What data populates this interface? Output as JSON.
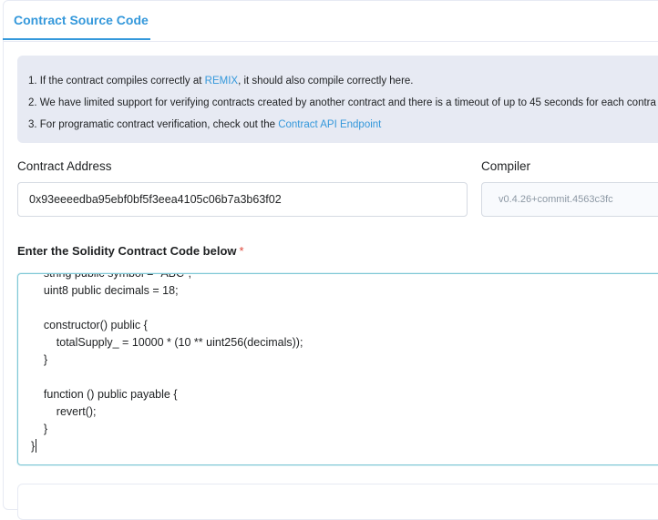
{
  "tabs": [
    {
      "label": "Contract Source Code",
      "active": true
    }
  ],
  "notice": {
    "item1_prefix": "1. If the contract compiles correctly at ",
    "item1_link": "REMIX",
    "item1_suffix": ", it should also compile correctly here.",
    "item2": "2. We have limited support for verifying contracts created by another contract and there is a timeout of up to 45 seconds for each contra",
    "item3_prefix": "3. For programatic contract verification, check out the ",
    "item3_link": "Contract API Endpoint"
  },
  "form": {
    "address_label": "Contract Address",
    "address_value": "0x93eeeedba95ebf0bf5f3eea4105c06b7a3b63f02",
    "compiler_label": "Compiler",
    "compiler_value": "v0.4.26+commit.4563c3fc",
    "code_label": "Enter the Solidity Contract Code below",
    "code_required_mark": "*",
    "code_value": "    string public symbol = \"ABC\";\n    uint8 public decimals = 18;\n\n    constructor() public {\n        totalSupply_ = 10000 * (10 ** uint256(decimals));\n    }\n\n    function () public payable {\n        revert();\n    }\n}"
  },
  "colors": {
    "accent": "#3498db",
    "notice_bg": "#e7eaf3",
    "required": "#de4437"
  }
}
